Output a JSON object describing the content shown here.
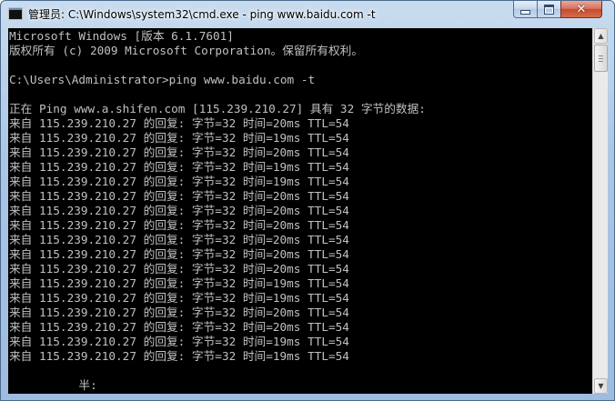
{
  "window": {
    "title": "管理员: C:\\Windows\\system32\\cmd.exe - ping  www.baidu.com -t",
    "icon": "cmd-icon",
    "controls": {
      "minimize_icon": "minimize-icon",
      "maximize_icon": "maximize-icon",
      "close_glyph": "✕"
    }
  },
  "console": {
    "lines": [
      "Microsoft Windows [版本 6.1.7601]",
      "版权所有 (c) 2009 Microsoft Corporation。保留所有权利。",
      "",
      "C:\\Users\\Administrator>ping www.baidu.com -t",
      "",
      "正在 Ping www.a.shifen.com [115.239.210.27] 具有 32 字节的数据:",
      "来自 115.239.210.27 的回复: 字节=32 时间=20ms TTL=54",
      "来自 115.239.210.27 的回复: 字节=32 时间=19ms TTL=54",
      "来自 115.239.210.27 的回复: 字节=32 时间=20ms TTL=54",
      "来自 115.239.210.27 的回复: 字节=32 时间=19ms TTL=54",
      "来自 115.239.210.27 的回复: 字节=32 时间=19ms TTL=54",
      "来自 115.239.210.27 的回复: 字节=32 时间=20ms TTL=54",
      "来自 115.239.210.27 的回复: 字节=32 时间=20ms TTL=54",
      "来自 115.239.210.27 的回复: 字节=32 时间=20ms TTL=54",
      "来自 115.239.210.27 的回复: 字节=32 时间=20ms TTL=54",
      "来自 115.239.210.27 的回复: 字节=32 时间=20ms TTL=54",
      "来自 115.239.210.27 的回复: 字节=32 时间=20ms TTL=54",
      "来自 115.239.210.27 的回复: 字节=32 时间=19ms TTL=54",
      "来自 115.239.210.27 的回复: 字节=32 时间=19ms TTL=54",
      "来自 115.239.210.27 的回复: 字节=32 时间=20ms TTL=54",
      "来自 115.239.210.27 的回复: 字节=32 时间=20ms TTL=54",
      "来自 115.239.210.27 的回复: 字节=32 时间=19ms TTL=54",
      "来自 115.239.210.27 的回复: 字节=32 时间=19ms TTL=54",
      "",
      "          半:"
    ]
  },
  "scrollbar": {
    "up_arrow": "▲",
    "down_arrow": "▼"
  },
  "colors": {
    "console_background": "#000000",
    "console_text": "#c0c0c0",
    "titlebar": "#aac6e4",
    "close_button": "#c44c2f"
  }
}
